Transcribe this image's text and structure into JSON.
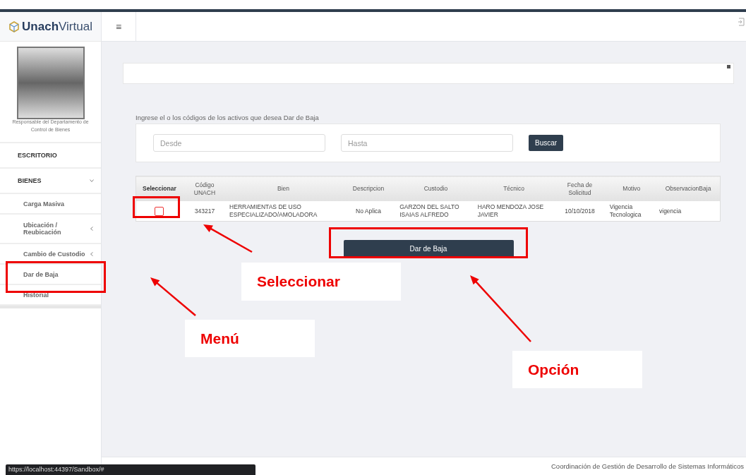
{
  "brand": {
    "name": "Unach",
    "suffix": "Virtual"
  },
  "header": {
    "menu_glyph": "≡"
  },
  "profile": {
    "caption": "Responsable del Departamento de Control de Bienes"
  },
  "sidebar": {
    "items": [
      {
        "label": "ESCRITORIO",
        "kind": "section"
      },
      {
        "label": "BIENES",
        "kind": "section_group",
        "expanded": true
      },
      {
        "label": "Carga Masiva",
        "kind": "link"
      },
      {
        "label": "Ubicación / Reubicación",
        "kind": "group",
        "expanded": false
      },
      {
        "label": "Cambio de Custodio",
        "kind": "group",
        "expanded": false
      },
      {
        "label": "Dar de Baja",
        "kind": "link"
      },
      {
        "label": "Historial",
        "kind": "link"
      }
    ]
  },
  "form": {
    "instruction": "Ingrese el o los códigos de los activos que desea Dar de Baja",
    "from_placeholder": "Desde",
    "to_placeholder": "Hasta",
    "search_button": "Buscar"
  },
  "table": {
    "columns": [
      "Seleccionar",
      "Código UNACH",
      "Bien",
      "Descripcion",
      "Custodio",
      "Técnico",
      "Fecha de Solicitud",
      "Motivo",
      "ObservacionBaja"
    ],
    "rows": [
      {
        "checked": false,
        "cells": [
          "",
          "343217",
          "HERRAMIENTAS DE USO ESPECIALIZADO/AMOLADORA",
          "No Aplica",
          "GARZON DEL SALTO ISAIAS ALFREDO",
          "HARO MENDOZA JOSE JAVIER",
          "10/10/2018",
          "Vigencia Tecnologica",
          "vigencia"
        ]
      }
    ]
  },
  "action_button": "Dar de Baja",
  "footer": {
    "right": "Coordinación de Gestión de Desarrollo de Sistemas Informáticos"
  },
  "status_url": "https://localhost:44397/Sandbox/#",
  "annotations": [
    {
      "label": "Seleccionar"
    },
    {
      "label": "Menú"
    },
    {
      "label": "Opción"
    }
  ]
}
